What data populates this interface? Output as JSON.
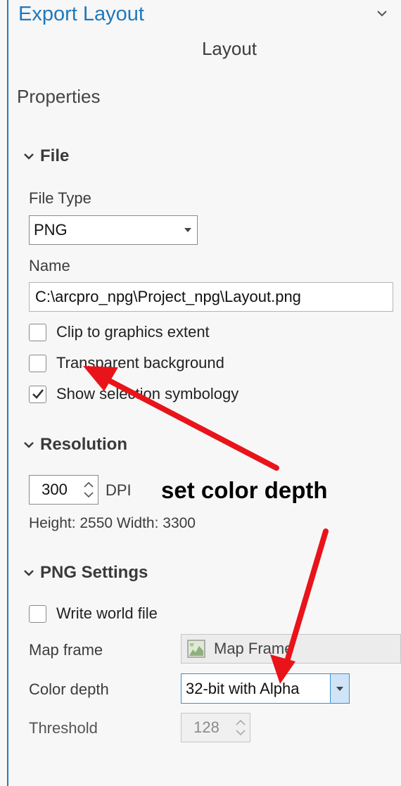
{
  "header": {
    "title": "Export Layout",
    "subtitle": "Layout",
    "properties_label": "Properties"
  },
  "file_section": {
    "heading": "File",
    "file_type_label": "File Type",
    "file_type_value": "PNG",
    "name_label": "Name",
    "name_value": "C:\\arcpro_npg\\Project_npg\\Layout.png",
    "checkboxes": [
      {
        "label": "Clip to graphics extent",
        "checked": false
      },
      {
        "label": "Transparent background",
        "checked": false
      },
      {
        "label": "Show selection symbology",
        "checked": true
      }
    ]
  },
  "resolution_section": {
    "heading": "Resolution",
    "dpi_value": "300",
    "dpi_unit": "DPI",
    "dimensions_text": "Height: 2550 Width: 3300"
  },
  "png_section": {
    "heading": "PNG Settings",
    "write_world_file_label": "Write world file",
    "map_frame_label": "Map frame",
    "map_frame_value": "Map Frame",
    "color_depth_label": "Color depth",
    "color_depth_value": "32-bit with Alpha",
    "threshold_label": "Threshold",
    "threshold_value": "128"
  },
  "annotation": {
    "text": "set color depth",
    "arrow_color": "#e8141a"
  },
  "colors": {
    "accent": "#1f79bd",
    "annotation_red": "#e8141a",
    "combo_highlight": "#cfe4f6"
  }
}
